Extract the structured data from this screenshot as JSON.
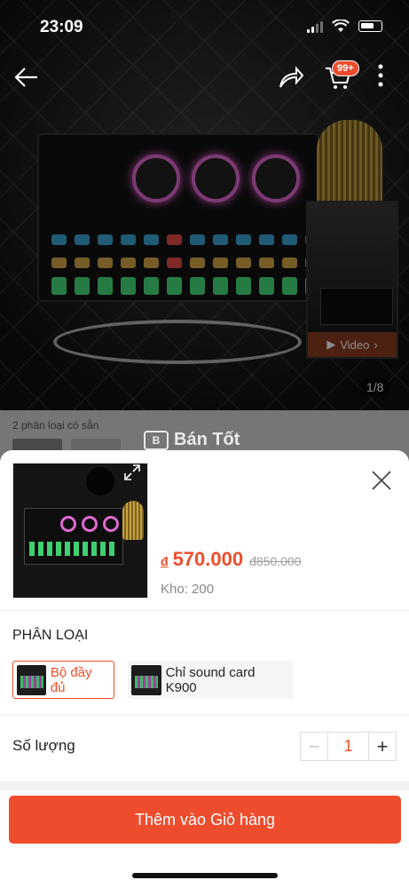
{
  "status_bar": {
    "time": "23:09"
  },
  "nav": {
    "cart_badge": "99+"
  },
  "gallery": {
    "page_indicator": "1/8",
    "video_label": "Video",
    "video_chevron": "›"
  },
  "variants_preview": {
    "text": "2 phân loại có sẵn"
  },
  "watermark": {
    "text": "Bán Tốt",
    "box": "B"
  },
  "product": {
    "currency": "đ",
    "price": "570.000",
    "original_price": "đ850.000",
    "stock": "Kho: 200"
  },
  "classification": {
    "title": "PHÂN LOẠI",
    "options": [
      {
        "label": "Bộ đầy đủ",
        "selected": true
      },
      {
        "label": "Chỉ sound card K900",
        "selected": false
      }
    ]
  },
  "quantity": {
    "label": "Số lượng",
    "value": "1",
    "minus": "−",
    "plus": "+"
  },
  "actions": {
    "add_to_cart": "Thêm vào Giỏ hàng"
  },
  "colors": {
    "accent": "#ee4d2d"
  }
}
